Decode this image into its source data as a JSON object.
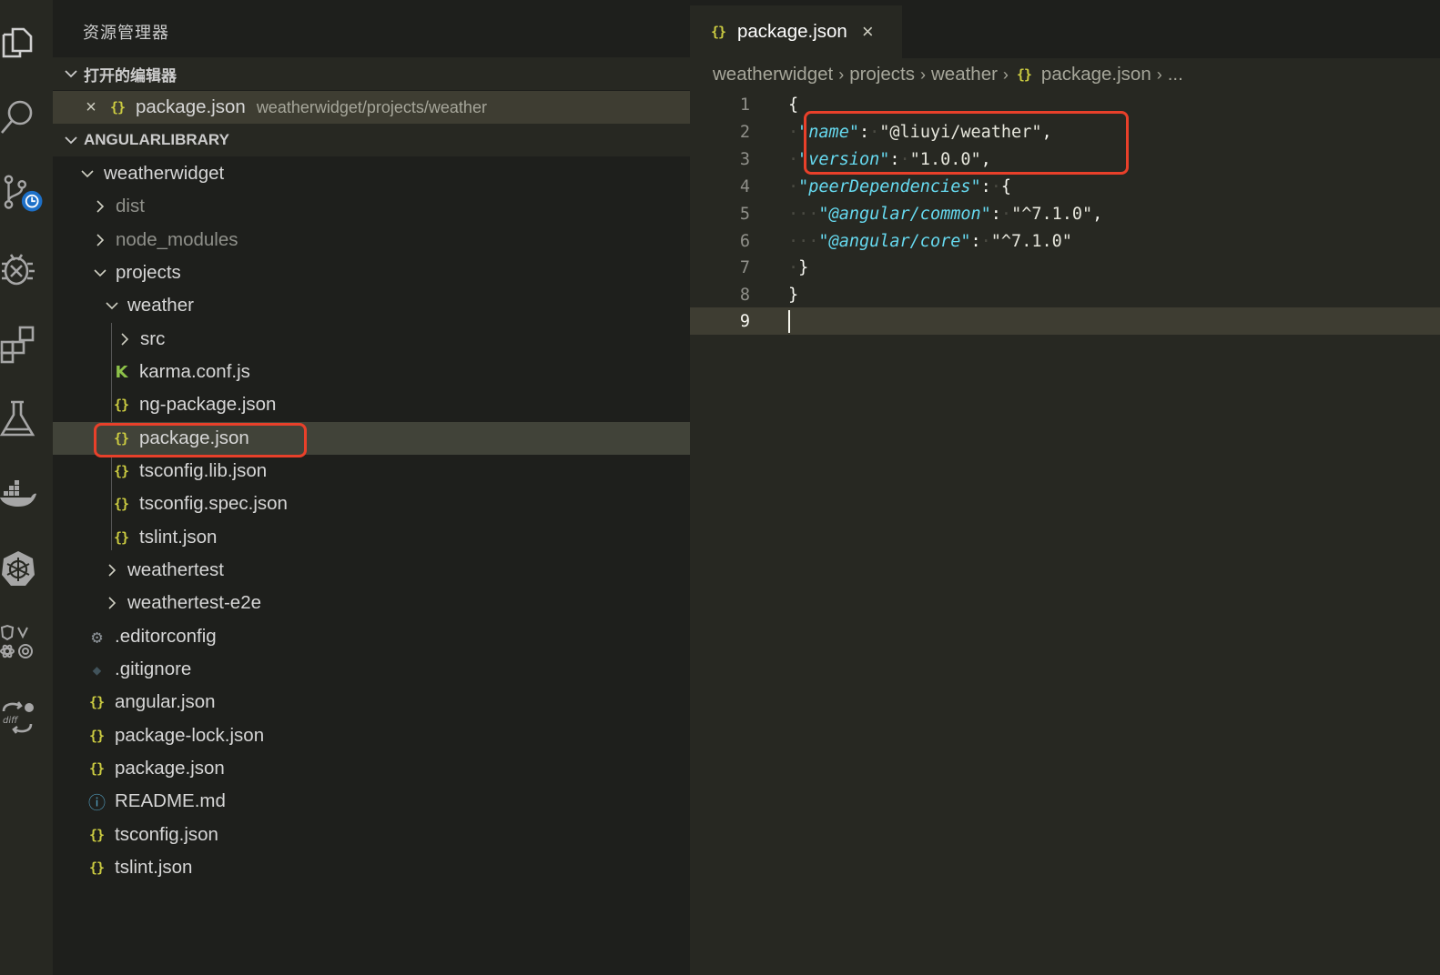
{
  "sidebar": {
    "title": "资源管理器",
    "open_editors_header": "打开的编辑器",
    "open_editor": {
      "close_glyph": "×",
      "icon": "{}",
      "name": "package.json",
      "path": "weatherwidget/projects/weather"
    },
    "workspace_header": "ANGULARLIBRARY",
    "tree": [
      {
        "name": "weatherwidget",
        "type": "folder-open"
      },
      {
        "name": "dist",
        "type": "folder-closed",
        "dimmed": true
      },
      {
        "name": "node_modules",
        "type": "folder-closed",
        "dimmed": true
      },
      {
        "name": "projects",
        "type": "folder-open"
      },
      {
        "name": "weather",
        "type": "folder-open"
      },
      {
        "name": "src",
        "type": "folder-closed"
      },
      {
        "name": "karma.conf.js",
        "icon": "K"
      },
      {
        "name": "ng-package.json",
        "icon": "{}"
      },
      {
        "name": "package.json",
        "icon": "{}",
        "selected": true
      },
      {
        "name": "tsconfig.lib.json",
        "icon": "{}"
      },
      {
        "name": "tsconfig.spec.json",
        "icon": "{}"
      },
      {
        "name": "tslint.json",
        "icon": "{}"
      },
      {
        "name": "weathertest",
        "type": "folder-closed"
      },
      {
        "name": "weathertest-e2e",
        "type": "folder-closed"
      },
      {
        "name": ".editorconfig",
        "icon": "⚙"
      },
      {
        "name": ".gitignore",
        "icon": "◆"
      },
      {
        "name": "angular.json",
        "icon": "{}"
      },
      {
        "name": "package-lock.json",
        "icon": "{}"
      },
      {
        "name": "package.json",
        "icon": "{}"
      },
      {
        "name": "README.md",
        "icon": "ⓘ"
      },
      {
        "name": "tsconfig.json",
        "icon": "{}"
      },
      {
        "name": "tslint.json",
        "icon": "{}"
      }
    ]
  },
  "editor": {
    "tab": {
      "icon": "{}",
      "label": "package.json",
      "close_glyph": "×"
    },
    "breadcrumb": [
      "weatherwidget",
      "projects",
      "weather",
      "package.json",
      "..."
    ],
    "breadcrumb_sep": "›",
    "line_numbers": [
      "1",
      "2",
      "3",
      "4",
      "5",
      "6",
      "7",
      "8",
      "9"
    ],
    "code": {
      "l1": "{",
      "l2_key": "name",
      "l2_val": "\"@liuyi/weather\"",
      "l3_key": "version",
      "l3_val": "\"1.0.0\"",
      "l4_key": "peerDependencies",
      "l5_key": "@angular/common",
      "l5_val": "\"^7.1.0\"",
      "l6_key": "@angular/core",
      "l6_val": "\"^7.1.0\"",
      "l7": "}",
      "l8": "}"
    }
  },
  "activity_bar": [
    "explorer-icon",
    "search-icon",
    "source-control-icon",
    "debug-icon",
    "extensions-icon",
    "test-flask-icon",
    "docker-icon",
    "kubernetes-icon",
    "framework-icon",
    "diff-icon"
  ],
  "colors": {
    "highlight": "#e8402a",
    "json_icon": "#cbcb41",
    "key": "#66d9ef",
    "selection": "#414339"
  }
}
